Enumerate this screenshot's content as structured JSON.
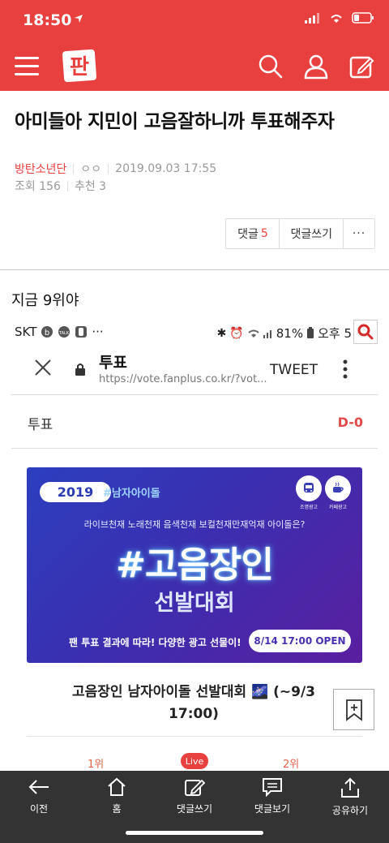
{
  "status": {
    "time": "18:50"
  },
  "app": {
    "logo": "판"
  },
  "post": {
    "title": "아미들아 지민이 고음잘하니까 투표해주자",
    "category": "방탄소년단",
    "author": "ㅇㅇ",
    "datetime": "2019.09.03 17:55",
    "views": "조회 156",
    "likes": "추천 3",
    "body": "지금 9위야"
  },
  "actions": {
    "comment_label": "댓글",
    "comment_count": "5",
    "write_label": "댓글쓰기",
    "more": "···"
  },
  "embedded": {
    "carrier": "SKT",
    "battery": "81%",
    "clock": "오후 5",
    "browser_title": "투표",
    "browser_url": "https://vote.fanplus.co.kr/?vot...",
    "tweet": "TWEET",
    "vote_label": "투표",
    "dday": "D-0",
    "banner": {
      "year": "2019",
      "tag": "#남자아이돌",
      "subtitle": "라이브천재 노래천재 음색천재 보컬천재만재억재 아이돌은?",
      "headline": "#고음장인",
      "headline2": "선발대회",
      "footer": "팬 투표 결과에 따라! 다양한 광고 선물이!",
      "open": "8/14 17:00 OPEN",
      "icon1": "조명광고",
      "icon2": "카페광고"
    },
    "event_title": "고음장인 남자아이돌 선발대회 🌌 (~9/3 17:00)",
    "rank1": "1위",
    "live": "Live",
    "rank2": "2위"
  },
  "bottom_nav": [
    {
      "label": "이전",
      "icon": "back-arrow-icon"
    },
    {
      "label": "홈",
      "icon": "home-icon"
    },
    {
      "label": "댓글쓰기",
      "icon": "edit-icon"
    },
    {
      "label": "댓글보기",
      "icon": "comment-icon"
    },
    {
      "label": "공유하기",
      "icon": "share-icon"
    }
  ],
  "colors": {
    "accent": "#e8403f",
    "bottom_bar": "#333333"
  }
}
